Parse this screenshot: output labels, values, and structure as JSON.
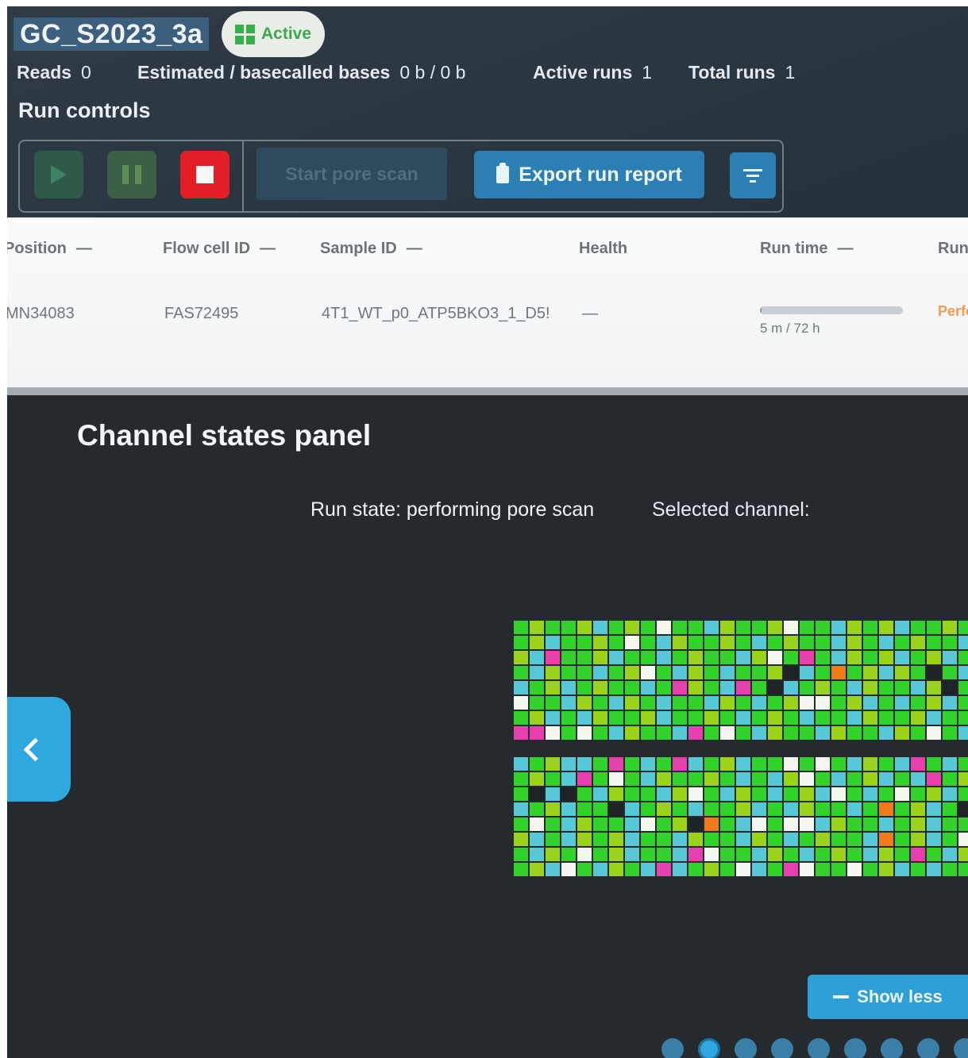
{
  "header": {
    "title": "GC_S2023_3a",
    "status_badge": "Active",
    "stats": [
      {
        "label": "Reads",
        "value": "0"
      },
      {
        "label": "Estimated / basecalled bases",
        "value": "0 b / 0 b"
      },
      {
        "label": "Active runs",
        "value": "1"
      },
      {
        "label": "Total runs",
        "value": "1"
      }
    ]
  },
  "run_controls": {
    "title": "Run controls",
    "start_pore_scan": "Start pore scan",
    "export_run_report": "Export run report"
  },
  "table": {
    "columns": [
      "Position",
      "Flow cell ID",
      "Sample ID",
      "Health",
      "Run time",
      "Run"
    ],
    "sort_dash": "—",
    "row": {
      "position": "MN34083",
      "flow_cell_id": "FAS72495",
      "sample_id": "4T1_WT_p0_ATP5BKO3_1_D5!",
      "health": "—",
      "run_time": "5 m / 72 h",
      "run_progress": 0.0012,
      "run_status": "Performing pore scan"
    }
  },
  "channel_panel": {
    "title": "Channel states panel",
    "run_state": "Run state: performing pore scan",
    "selected_channel": "Selected channel:",
    "show_less": "Show less",
    "page_dots": 9,
    "active_dot": 1,
    "colors": {
      "G": "#31d22a",
      "L": "#9bd21a",
      "C": "#56c8d6",
      "W": "#f3f5ef",
      "M": "#e83fae",
      "O": "#f07a1c",
      "K": "#1e2326"
    },
    "blocks": [
      [
        "GLGGLCGLGWGGCLGGLWGGCLGLCGGLG",
        "GLCGGLGWGCLGGLGCGLGGCLGCGLGGC",
        "LCMGGLCGGCGLGGCLWGMGCLGLCGLCG",
        "GCLGGCGLWGCLGCGGLKCGOGLCLGKGC",
        "CGLCGLGGCGMLGCMGKCGLGCLGGCLKG",
        "WGGCLGCLGCGGCLGCGLWWGLCGCGLCG",
        "GLCGCLGGLCGGLGCGLGCGGCLGGLCGG",
        "MMWGWGCLGGCMGWGCLGGCLGGCLGWGC"
      ],
      [
        "CGLCCGMGCGMCGLCGGWGWGCLGCMGCG",
        "GLGCMGWGCLGGLGCGCLWGCGLCGCMGL",
        "GKCKGCLGGCLWGCLGCGLCWGCGWGLCG",
        "CGLCGGKCGLGCGGLCGCLGGCGOGLCGK",
        "GWGCLGGCWGLKOGCWGWWCLGGCGLCGG",
        "LCGCLGLCGGCLGGCLGCGLGGCOGLCGW",
        "GCLGWGLCGGCMWGGCLGCGLGCLGMGCL",
        "GLCWGCLGCMCGLGWCGMWGGWGLCGCGG"
      ]
    ]
  }
}
